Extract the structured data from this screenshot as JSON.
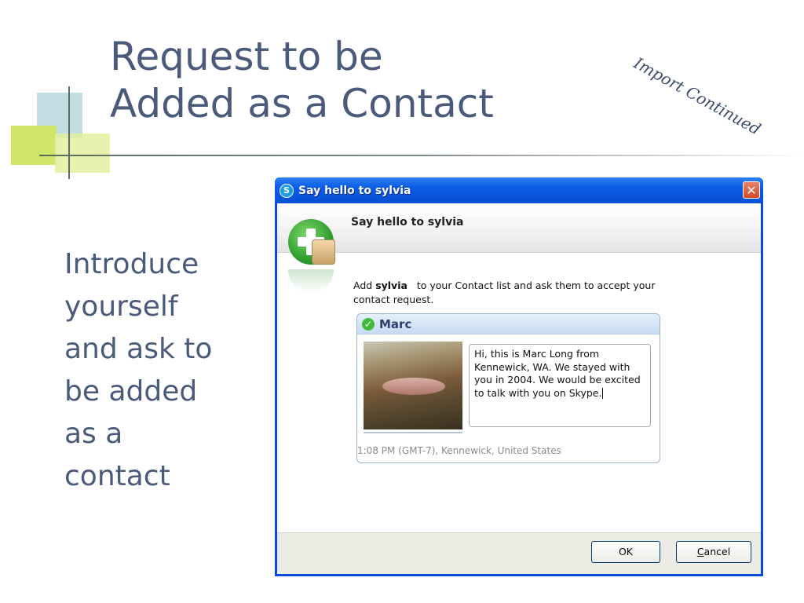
{
  "slide": {
    "title_line1": "Request to be",
    "title_line2": "Added as a Contact",
    "corner_note": "Import Continued",
    "body_lines": [
      "Introduce",
      "yourself",
      "and ask to",
      "be added",
      "as a",
      "contact"
    ]
  },
  "dialog": {
    "window_title": "Say hello to sylvia",
    "app_icon": "skype-icon",
    "header_title": "Say hello to sylvia",
    "desc_prefix": "Add ",
    "desc_contact": "sylvia",
    "desc_suffix": "   to your Contact list and ask them to accept your contact request.",
    "card": {
      "name": "Marc",
      "status_icon": "online-check-icon",
      "message": "Hi, this is Marc Long from Kennewick, WA.  We stayed with you in 2004.  We would be excited to talk with you on Skype.",
      "footer": "1:08 PM (GMT-7), Kennewick, United States"
    },
    "buttons": {
      "ok_label": "OK",
      "cancel_underlined": "C",
      "cancel_rest": "ancel"
    }
  },
  "colors": {
    "slide_text": "#4a5a7a",
    "titlebar_blue": "#0a5ce4",
    "close_red": "#d24a2a",
    "card_name": "#2a3e6e"
  }
}
